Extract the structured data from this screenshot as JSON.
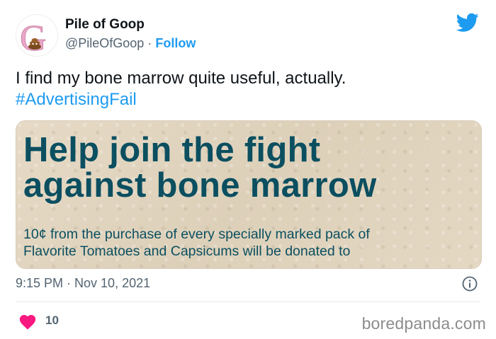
{
  "author": {
    "name": "Pile of Goop",
    "handle": "@PileOfGoop",
    "separator": "·",
    "follow_label": "Follow",
    "avatar_letter": "G",
    "avatar_icon": "poop-emoji-icon"
  },
  "tweet": {
    "text": "I find my bone marrow quite useful, actually.",
    "hashtag": "#AdvertisingFail"
  },
  "media": {
    "headline_line1": "Help join the fight",
    "headline_line2": "against bone marrow",
    "body_line1": "10¢ from the purchase of every specially marked pack of",
    "body_line2": "Flavorite Tomatoes and Capsicums will be donated to"
  },
  "timestamp": "9:15 PM · Nov 10, 2021",
  "likes": "10",
  "watermark": "boredpanda.com",
  "colors": {
    "accent": "#1d9bf0",
    "heart": "#f91880",
    "headline": "#0b4f60",
    "avatar_letter": "#e9a6c6"
  }
}
